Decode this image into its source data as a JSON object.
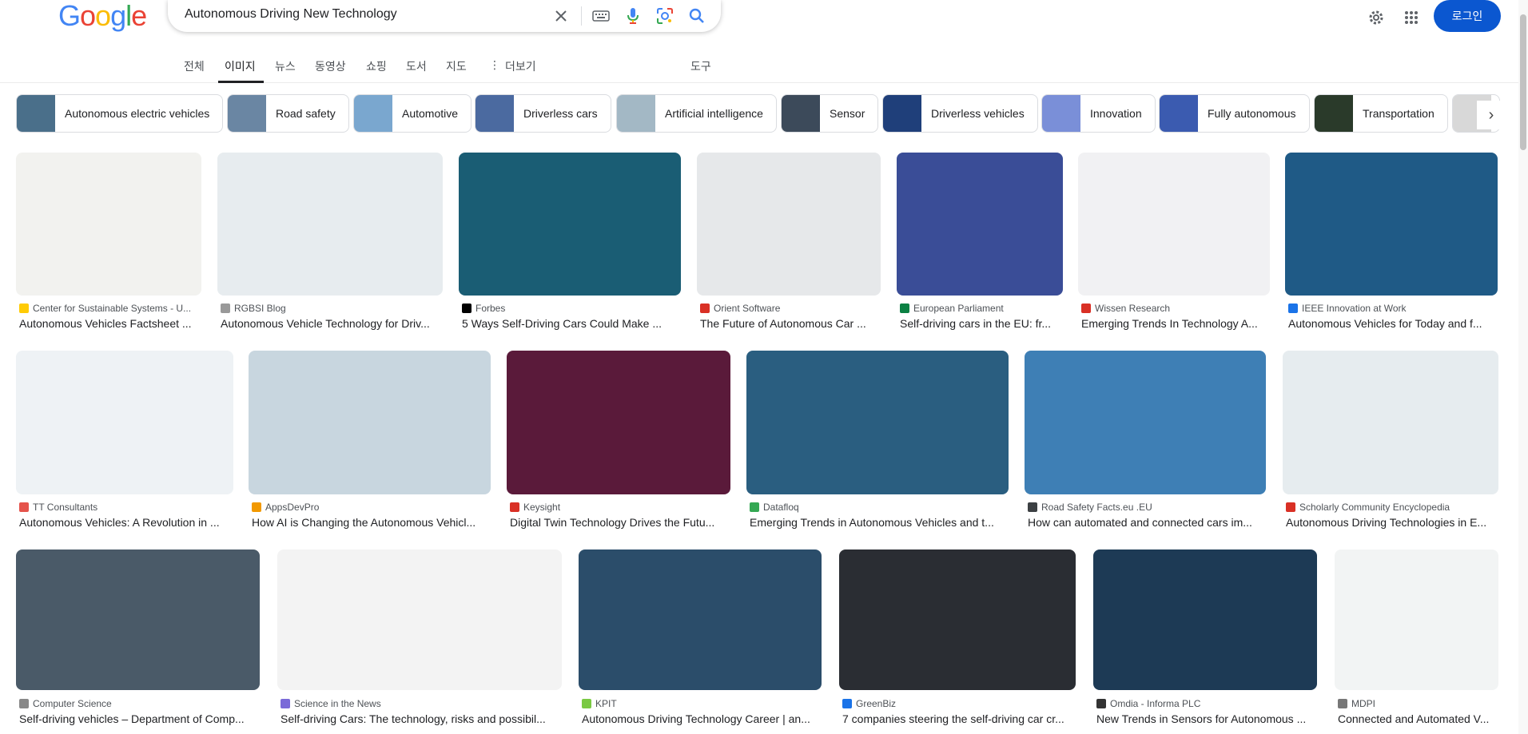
{
  "search": {
    "query": "Autonomous Driving New Technology"
  },
  "header": {
    "login_label": "로그인"
  },
  "tabs": [
    {
      "label": "전체"
    },
    {
      "label": "이미지"
    },
    {
      "label": "뉴스"
    },
    {
      "label": "동영상"
    },
    {
      "label": "쇼핑"
    },
    {
      "label": "도서"
    },
    {
      "label": "지도"
    },
    {
      "label": "더보기"
    },
    {
      "label": "도구"
    }
  ],
  "chips": [
    {
      "label": "Autonomous electric vehicles",
      "color": "#4a6f8a"
    },
    {
      "label": "Road safety",
      "color": "#6a86a3"
    },
    {
      "label": "Automotive",
      "color": "#7aa7cf"
    },
    {
      "label": "Driverless cars",
      "color": "#4b6aa0"
    },
    {
      "label": "Artificial intelligence",
      "color": "#a3b8c5"
    },
    {
      "label": "Sensor",
      "color": "#3c4a5a"
    },
    {
      "label": "Driverless vehicles",
      "color": "#1f3f7a"
    },
    {
      "label": "Innovation",
      "color": "#7a8fd8"
    },
    {
      "label": "Fully autonomous",
      "color": "#3b5bb0"
    },
    {
      "label": "Transportation",
      "color": "#2a3a2a"
    },
    {
      "label": "",
      "color": "#d8d8d8"
    }
  ],
  "results": [
    {
      "source": "Center for Sustainable Systems - U...",
      "title": "Autonomous Vehicles Factsheet ...",
      "img_color": "#f2f2ef",
      "fav_color": "#ffcb05"
    },
    {
      "source": "RGBSI Blog",
      "title": "Autonomous Vehicle Technology for Driv...",
      "img_color": "#e7ecef",
      "fav_color": "#999999"
    },
    {
      "source": "Forbes",
      "title": "5 Ways Self-Driving Cars Could Make ...",
      "img_color": "#1a5d74",
      "fav_color": "#000000"
    },
    {
      "source": "Orient Software",
      "title": "The Future of Autonomous Car ...",
      "img_color": "#e6e8ea",
      "fav_color": "#d93025"
    },
    {
      "source": "European Parliament",
      "title": "Self-driving cars in the EU: fr...",
      "img_color": "#3a4d97",
      "fav_color": "#0b8043"
    },
    {
      "source": "Wissen Research",
      "title": "Emerging Trends In Technology A...",
      "img_color": "#f1f1f3",
      "fav_color": "#d93025"
    },
    {
      "source": "IEEE Innovation at Work",
      "title": "Autonomous Vehicles for Today and f...",
      "img_color": "#1f5a86",
      "fav_color": "#1a73e8"
    },
    {
      "source": "TT Consultants",
      "title": "Autonomous Vehicles: A Revolution in ...",
      "img_color": "#eef2f5",
      "fav_color": "#e5534b"
    },
    {
      "source": "AppsDevPro",
      "title": "How AI is Changing the Autonomous Vehicl...",
      "img_color": "#c8d6df",
      "fav_color": "#f29900"
    },
    {
      "source": "Keysight",
      "title": "Digital Twin Technology Drives the Futu...",
      "img_color": "#5a1a3a",
      "fav_color": "#d93025"
    },
    {
      "source": "Datafloq",
      "title": "Emerging Trends in Autonomous Vehicles and t...",
      "img_color": "#2a5e80",
      "fav_color": "#34a853"
    },
    {
      "source": "Road Safety Facts.eu .EU",
      "title": "How can automated and connected cars im...",
      "img_color": "#3e7fb5",
      "fav_color": "#3c4043"
    },
    {
      "source": "Scholarly Community Encyclopedia",
      "title": "Autonomous Driving Technologies in E...",
      "img_color": "#e6ecef",
      "fav_color": "#d93025"
    },
    {
      "source": "Computer Science",
      "title": "Self-driving vehicles – Department of Comp...",
      "img_color": "#4a5a68",
      "fav_color": "#888888"
    },
    {
      "source": "Science in the News",
      "title": "Self-driving Cars: The technology, risks and possibil...",
      "img_color": "#f3f3f3",
      "fav_color": "#7a6ad8"
    },
    {
      "source": "KPIT",
      "title": "Autonomous Driving Technology Career | an...",
      "img_color": "#2b4d6a",
      "fav_color": "#7ac943"
    },
    {
      "source": "GreenBiz",
      "title": "7 companies steering the self-driving car cr...",
      "img_color": "#2a2d33",
      "fav_color": "#1a73e8"
    },
    {
      "source": "Omdia - Informa PLC",
      "title": "New Trends in Sensors for Autonomous ...",
      "img_color": "#1d3a55",
      "fav_color": "#333333"
    },
    {
      "source": "MDPI",
      "title": "Connected and Automated V...",
      "img_color": "#f2f4f4",
      "fav_color": "#777777"
    }
  ]
}
